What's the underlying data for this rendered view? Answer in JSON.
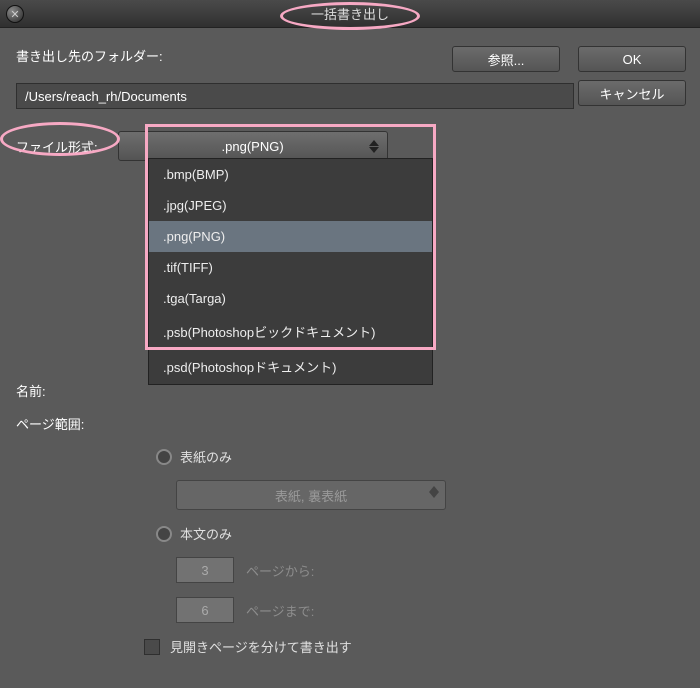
{
  "titlebar": {
    "title": "一括書き出し"
  },
  "buttons": {
    "browse": "参照...",
    "ok": "OK",
    "cancel": "キャンセル"
  },
  "folder": {
    "label": "書き出し先のフォルダー:",
    "path": "/Users/reach_rh/Documents"
  },
  "format": {
    "label": "ファイル形式:",
    "selected": ".png(PNG)",
    "options": [
      ".bmp(BMP)",
      ".jpg(JPEG)",
      ".png(PNG)",
      ".tif(TIFF)",
      ".tga(Targa)",
      ".psb(Photoshopビックドキュメント)",
      ".psd(Photoshopドキュメント)"
    ]
  },
  "name": {
    "label": "名前:"
  },
  "pagerange": {
    "label": "ページ範囲:",
    "cover_only": "表紙のみ",
    "cover_select": "表紙, 裏表紙",
    "body_only": "本文のみ",
    "from_value": "3",
    "from_label": "ページから:",
    "to_value": "6",
    "to_label": "ページまで:"
  },
  "spread": {
    "label": "見開きページを分けて書き出す"
  }
}
